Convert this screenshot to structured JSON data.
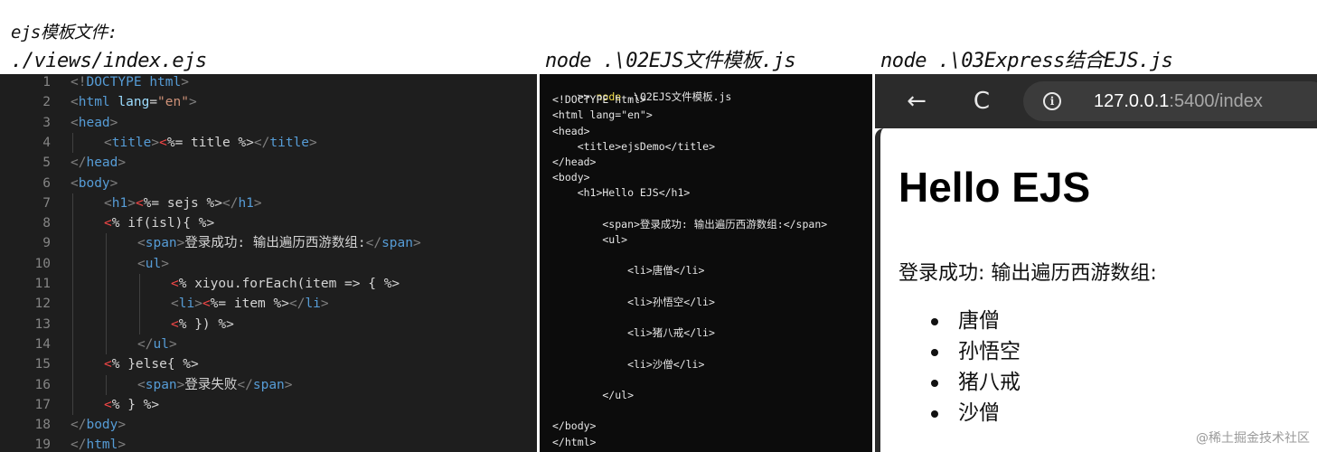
{
  "captions": {
    "panel1_line1": "ejs模板文件:",
    "panel1_line2": "./views/index.ejs",
    "panel2": "node .\\02EJS文件模板.js",
    "panel3": "node .\\03Express结合EJS.js"
  },
  "editor": {
    "lines": [
      {
        "n": "1",
        "indent": 0,
        "tokens": [
          [
            "bracket",
            "<!"
          ],
          [
            "tag",
            "DOCTYPE"
          ],
          [
            "text",
            " "
          ],
          [
            "tag",
            "html"
          ],
          [
            "bracket",
            ">"
          ]
        ]
      },
      {
        "n": "2",
        "indent": 0,
        "tokens": [
          [
            "bracket",
            "<"
          ],
          [
            "tag",
            "html"
          ],
          [
            "text",
            " "
          ],
          [
            "attr",
            "lang"
          ],
          [
            "text",
            "="
          ],
          [
            "str",
            "\"en\""
          ],
          [
            "bracket",
            ">"
          ]
        ]
      },
      {
        "n": "3",
        "indent": 0,
        "tokens": [
          [
            "bracket",
            "<"
          ],
          [
            "tag",
            "head"
          ],
          [
            "bracket",
            ">"
          ]
        ]
      },
      {
        "n": "4",
        "indent": 1,
        "tokens": [
          [
            "bracket",
            "<"
          ],
          [
            "tag",
            "title"
          ],
          [
            "bracket",
            ">"
          ],
          [
            "ejs",
            "<"
          ],
          [
            "js",
            "%= title %>"
          ],
          [
            "bracket",
            "</"
          ],
          [
            "tag",
            "title"
          ],
          [
            "bracket",
            ">"
          ]
        ]
      },
      {
        "n": "5",
        "indent": 0,
        "tokens": [
          [
            "bracket",
            "</"
          ],
          [
            "tag",
            "head"
          ],
          [
            "bracket",
            ">"
          ]
        ]
      },
      {
        "n": "6",
        "indent": 0,
        "tokens": [
          [
            "bracket",
            "<"
          ],
          [
            "tag",
            "body"
          ],
          [
            "bracket",
            ">"
          ]
        ]
      },
      {
        "n": "7",
        "indent": 1,
        "tokens": [
          [
            "bracket",
            "<"
          ],
          [
            "tag",
            "h1"
          ],
          [
            "bracket",
            ">"
          ],
          [
            "ejs",
            "<"
          ],
          [
            "js",
            "%= sejs %>"
          ],
          [
            "bracket",
            "</"
          ],
          [
            "tag",
            "h1"
          ],
          [
            "bracket",
            ">"
          ]
        ]
      },
      {
        "n": "8",
        "indent": 1,
        "tokens": [
          [
            "ejs",
            "<"
          ],
          [
            "js",
            "% if(isl){ %>"
          ]
        ]
      },
      {
        "n": "9",
        "indent": 2,
        "tokens": [
          [
            "bracket",
            "<"
          ],
          [
            "tag",
            "span"
          ],
          [
            "bracket",
            ">"
          ],
          [
            "text",
            "登录成功: 输出遍历西游数组:"
          ],
          [
            "bracket",
            "</"
          ],
          [
            "tag",
            "span"
          ],
          [
            "bracket",
            ">"
          ]
        ]
      },
      {
        "n": "10",
        "indent": 2,
        "tokens": [
          [
            "bracket",
            "<"
          ],
          [
            "tag",
            "ul"
          ],
          [
            "bracket",
            ">"
          ]
        ]
      },
      {
        "n": "11",
        "indent": 3,
        "tokens": [
          [
            "ejs",
            "<"
          ],
          [
            "js",
            "% xiyou.forEach(item => { %>"
          ]
        ]
      },
      {
        "n": "12",
        "indent": 3,
        "tokens": [
          [
            "bracket",
            "<"
          ],
          [
            "tag",
            "li"
          ],
          [
            "bracket",
            ">"
          ],
          [
            "ejs",
            "<"
          ],
          [
            "js",
            "%= item %>"
          ],
          [
            "bracket",
            "</"
          ],
          [
            "tag",
            "li"
          ],
          [
            "bracket",
            ">"
          ]
        ]
      },
      {
        "n": "13",
        "indent": 3,
        "tokens": [
          [
            "ejs",
            "<"
          ],
          [
            "js",
            "% }) %>"
          ]
        ]
      },
      {
        "n": "14",
        "indent": 2,
        "tokens": [
          [
            "bracket",
            "</"
          ],
          [
            "tag",
            "ul"
          ],
          [
            "bracket",
            ">"
          ]
        ]
      },
      {
        "n": "15",
        "indent": 1,
        "tokens": [
          [
            "ejs",
            "<"
          ],
          [
            "js",
            "% }else{ %>"
          ]
        ]
      },
      {
        "n": "16",
        "indent": 2,
        "tokens": [
          [
            "bracket",
            "<"
          ],
          [
            "tag",
            "span"
          ],
          [
            "bracket",
            ">"
          ],
          [
            "text",
            "登录失败"
          ],
          [
            "bracket",
            "</"
          ],
          [
            "tag",
            "span"
          ],
          [
            "bracket",
            ">"
          ]
        ]
      },
      {
        "n": "17",
        "indent": 1,
        "tokens": [
          [
            "ejs",
            "<"
          ],
          [
            "js",
            "% } %>"
          ]
        ]
      },
      {
        "n": "18",
        "indent": 0,
        "tokens": [
          [
            "bracket",
            "</"
          ],
          [
            "tag",
            "body"
          ],
          [
            "bracket",
            ">"
          ]
        ]
      },
      {
        "n": "19",
        "indent": 0,
        "tokens": [
          [
            "bracket",
            "</"
          ],
          [
            "tag",
            "html"
          ],
          [
            "bracket",
            ">"
          ]
        ]
      }
    ]
  },
  "terminal": {
    "prompt": ">> ",
    "command": "node",
    "command_arg": " .\\02EJS文件模板.js",
    "output": [
      {
        "text": "<!DOCTYPE html>",
        "row": 1
      },
      {
        "text": "<html lang=\"en\">",
        "row": 2
      },
      {
        "text": "<head>",
        "row": 3
      },
      {
        "text": "    <title>ejsDemo</title>",
        "row": 4
      },
      {
        "text": "</head>",
        "row": 5
      },
      {
        "text": "<body>",
        "row": 6
      },
      {
        "text": "    <h1>Hello EJS</h1>",
        "row": 7
      },
      {
        "text": "        <span>登录成功: 输出遍历西游数组:</span>",
        "row": 9
      },
      {
        "text": "        <ul>",
        "row": 10
      },
      {
        "text": "            <li>唐僧</li>",
        "row": 12
      },
      {
        "text": "            <li>孙悟空</li>",
        "row": 14
      },
      {
        "text": "            <li>猪八戒</li>",
        "row": 16
      },
      {
        "text": "            <li>沙僧</li>",
        "row": 18
      },
      {
        "text": "        </ul>",
        "row": 20
      },
      {
        "text": "</body>",
        "row": 22
      },
      {
        "text": "</html>",
        "row": 23
      }
    ]
  },
  "browser": {
    "back_icon": "←",
    "reload_icon": "C",
    "info_icon": "i",
    "url_host": "127.0.0.1",
    "url_rest": ":5400/index",
    "page": {
      "heading": "Hello EJS",
      "message": "登录成功: 输出遍历西游数组:",
      "items": [
        "唐僧",
        "孙悟空",
        "猪八戒",
        "沙僧"
      ]
    }
  },
  "watermark": "@稀土掘金技术社区"
}
